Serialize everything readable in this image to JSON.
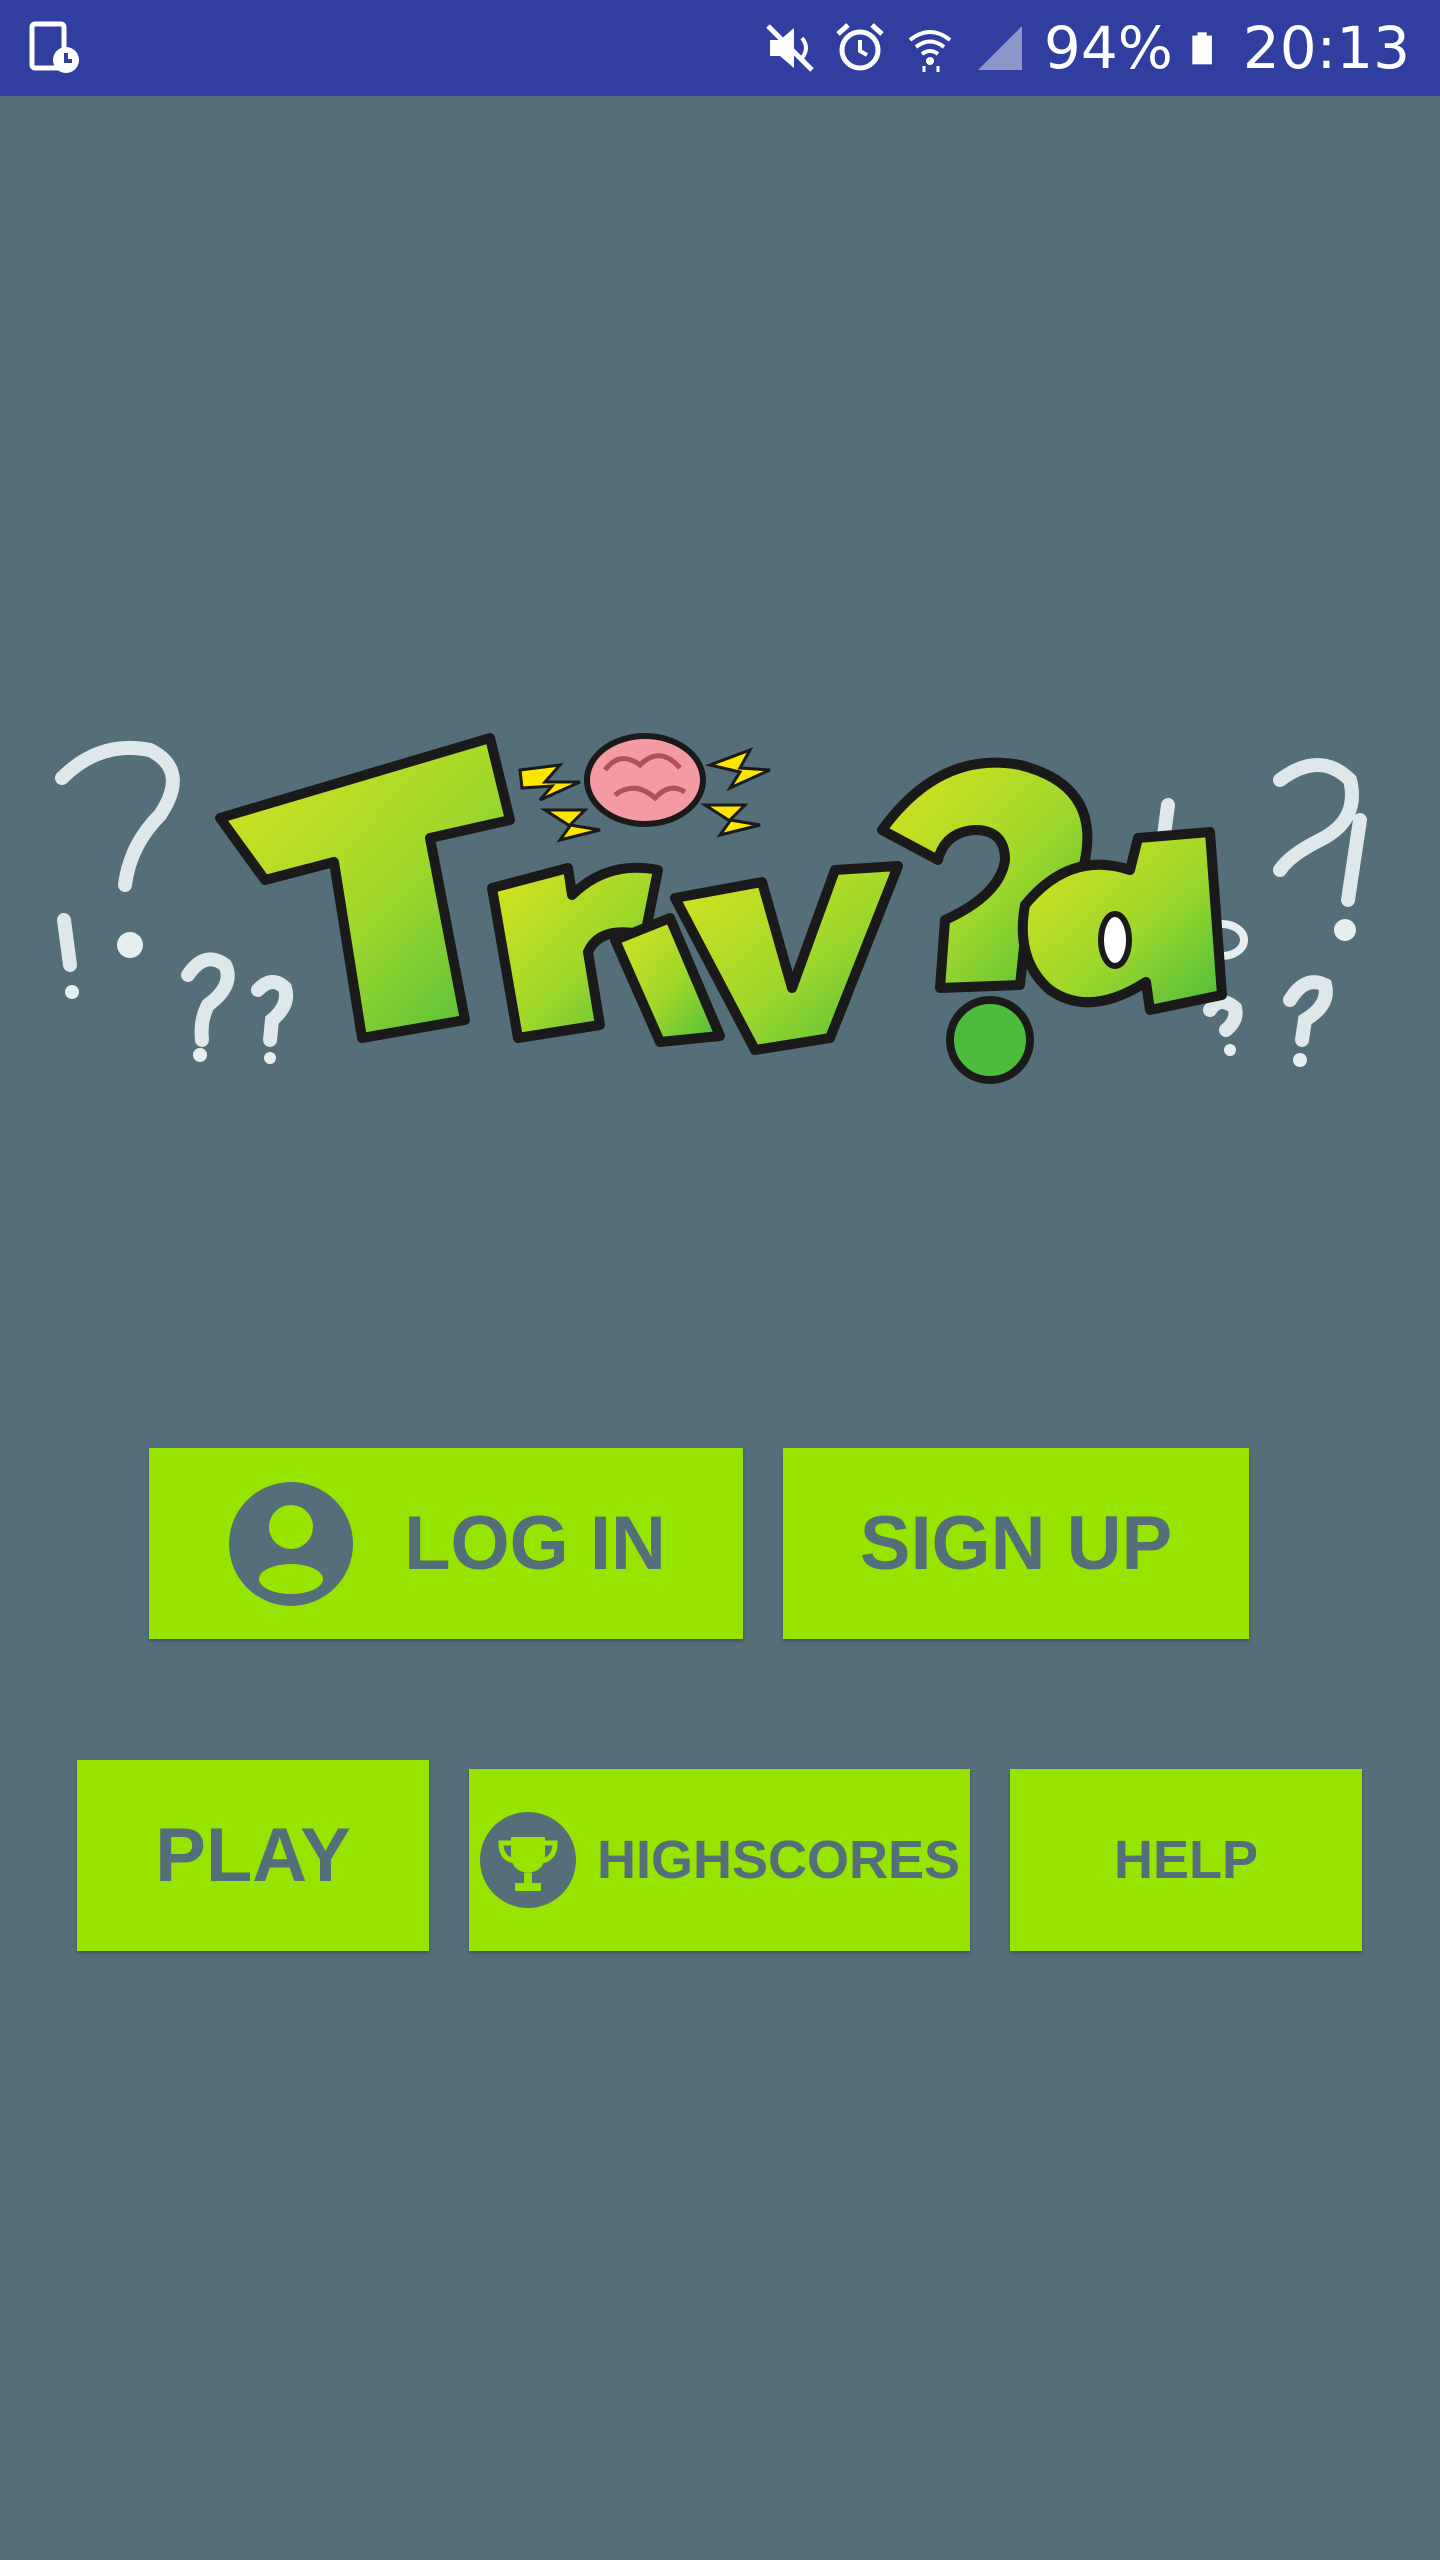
{
  "status_bar": {
    "battery": "94%",
    "time": "20:13",
    "icons": [
      "screen-time-icon",
      "mute-icon",
      "alarm-icon",
      "wifi-icon",
      "signal-icon",
      "battery-icon"
    ]
  },
  "logo": {
    "text": "Triv?a"
  },
  "buttons": {
    "login": "LOG IN",
    "signup": "SIGN UP",
    "play": "PLAY",
    "highscores": "HIGHSCORES",
    "help": "HELP"
  },
  "colors": {
    "background": "#546e7a",
    "status_bar": "#303f9f",
    "button": "#97e400",
    "button_text": "#546e7a"
  }
}
